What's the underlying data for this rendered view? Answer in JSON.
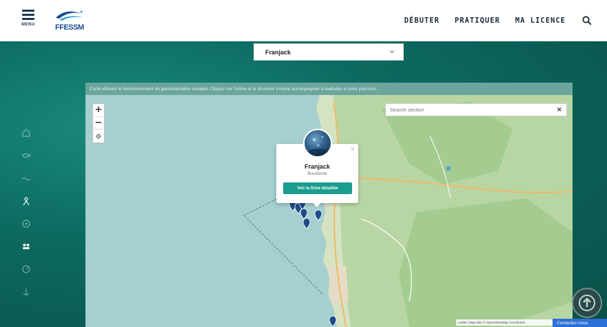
{
  "header": {
    "menu_label": "MENU",
    "logo_text": "FFESSM",
    "nav": [
      {
        "label": "DÉBUTER"
      },
      {
        "label": "PRATIQUER"
      },
      {
        "label": "MA LICENCE"
      }
    ]
  },
  "site_select": {
    "value": "Franjack"
  },
  "map": {
    "info_text": "Carte utilisant le fonctionnement de géolocalisation variable. Cliquez sur l'icône et la structure s'ouvre accompagnée à réalisées à notre parcours.",
    "search_placeholder": "Search section",
    "popup": {
      "title": "Franjack",
      "subtitle": "Bouillante",
      "button_label": "Voir la fiche détaillée"
    },
    "attribution": "Leaflet | Map data © OpenStreetMap contributors",
    "contact_label": "Contactez-nous"
  },
  "colors": {
    "accent": "#1a9c8e",
    "header_text": "#1a2a3a",
    "marker": "#1e4d8a"
  }
}
